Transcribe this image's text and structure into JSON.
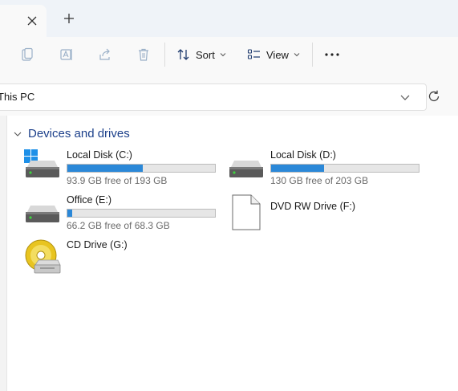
{
  "tabs": {
    "close_icon": "close-icon",
    "new_tab_icon": "plus-icon"
  },
  "toolbar": {
    "sort_label": "Sort",
    "view_label": "View"
  },
  "address": {
    "path": "This PC"
  },
  "section": {
    "title": "Devices and drives"
  },
  "drives": [
    {
      "name": "Local Disk (C:)",
      "free": "93.9 GB free of 193 GB",
      "used_fraction": 0.51,
      "icon": "windows-drive-icon"
    },
    {
      "name": "Local Disk (D:)",
      "free": "130 GB free of 203 GB",
      "used_fraction": 0.36,
      "icon": "hard-drive-icon"
    },
    {
      "name": "Office (E:)",
      "free": "66.2 GB free of 68.3 GB",
      "used_fraction": 0.03,
      "icon": "hard-drive-icon"
    },
    {
      "name": "DVD RW Drive (F:)",
      "icon": "dvd-drive-icon"
    },
    {
      "name": "CD Drive (G:)",
      "icon": "cd-drive-icon"
    }
  ],
  "colors": {
    "accent": "#2b88d8",
    "section_title": "#1b3f8a"
  }
}
